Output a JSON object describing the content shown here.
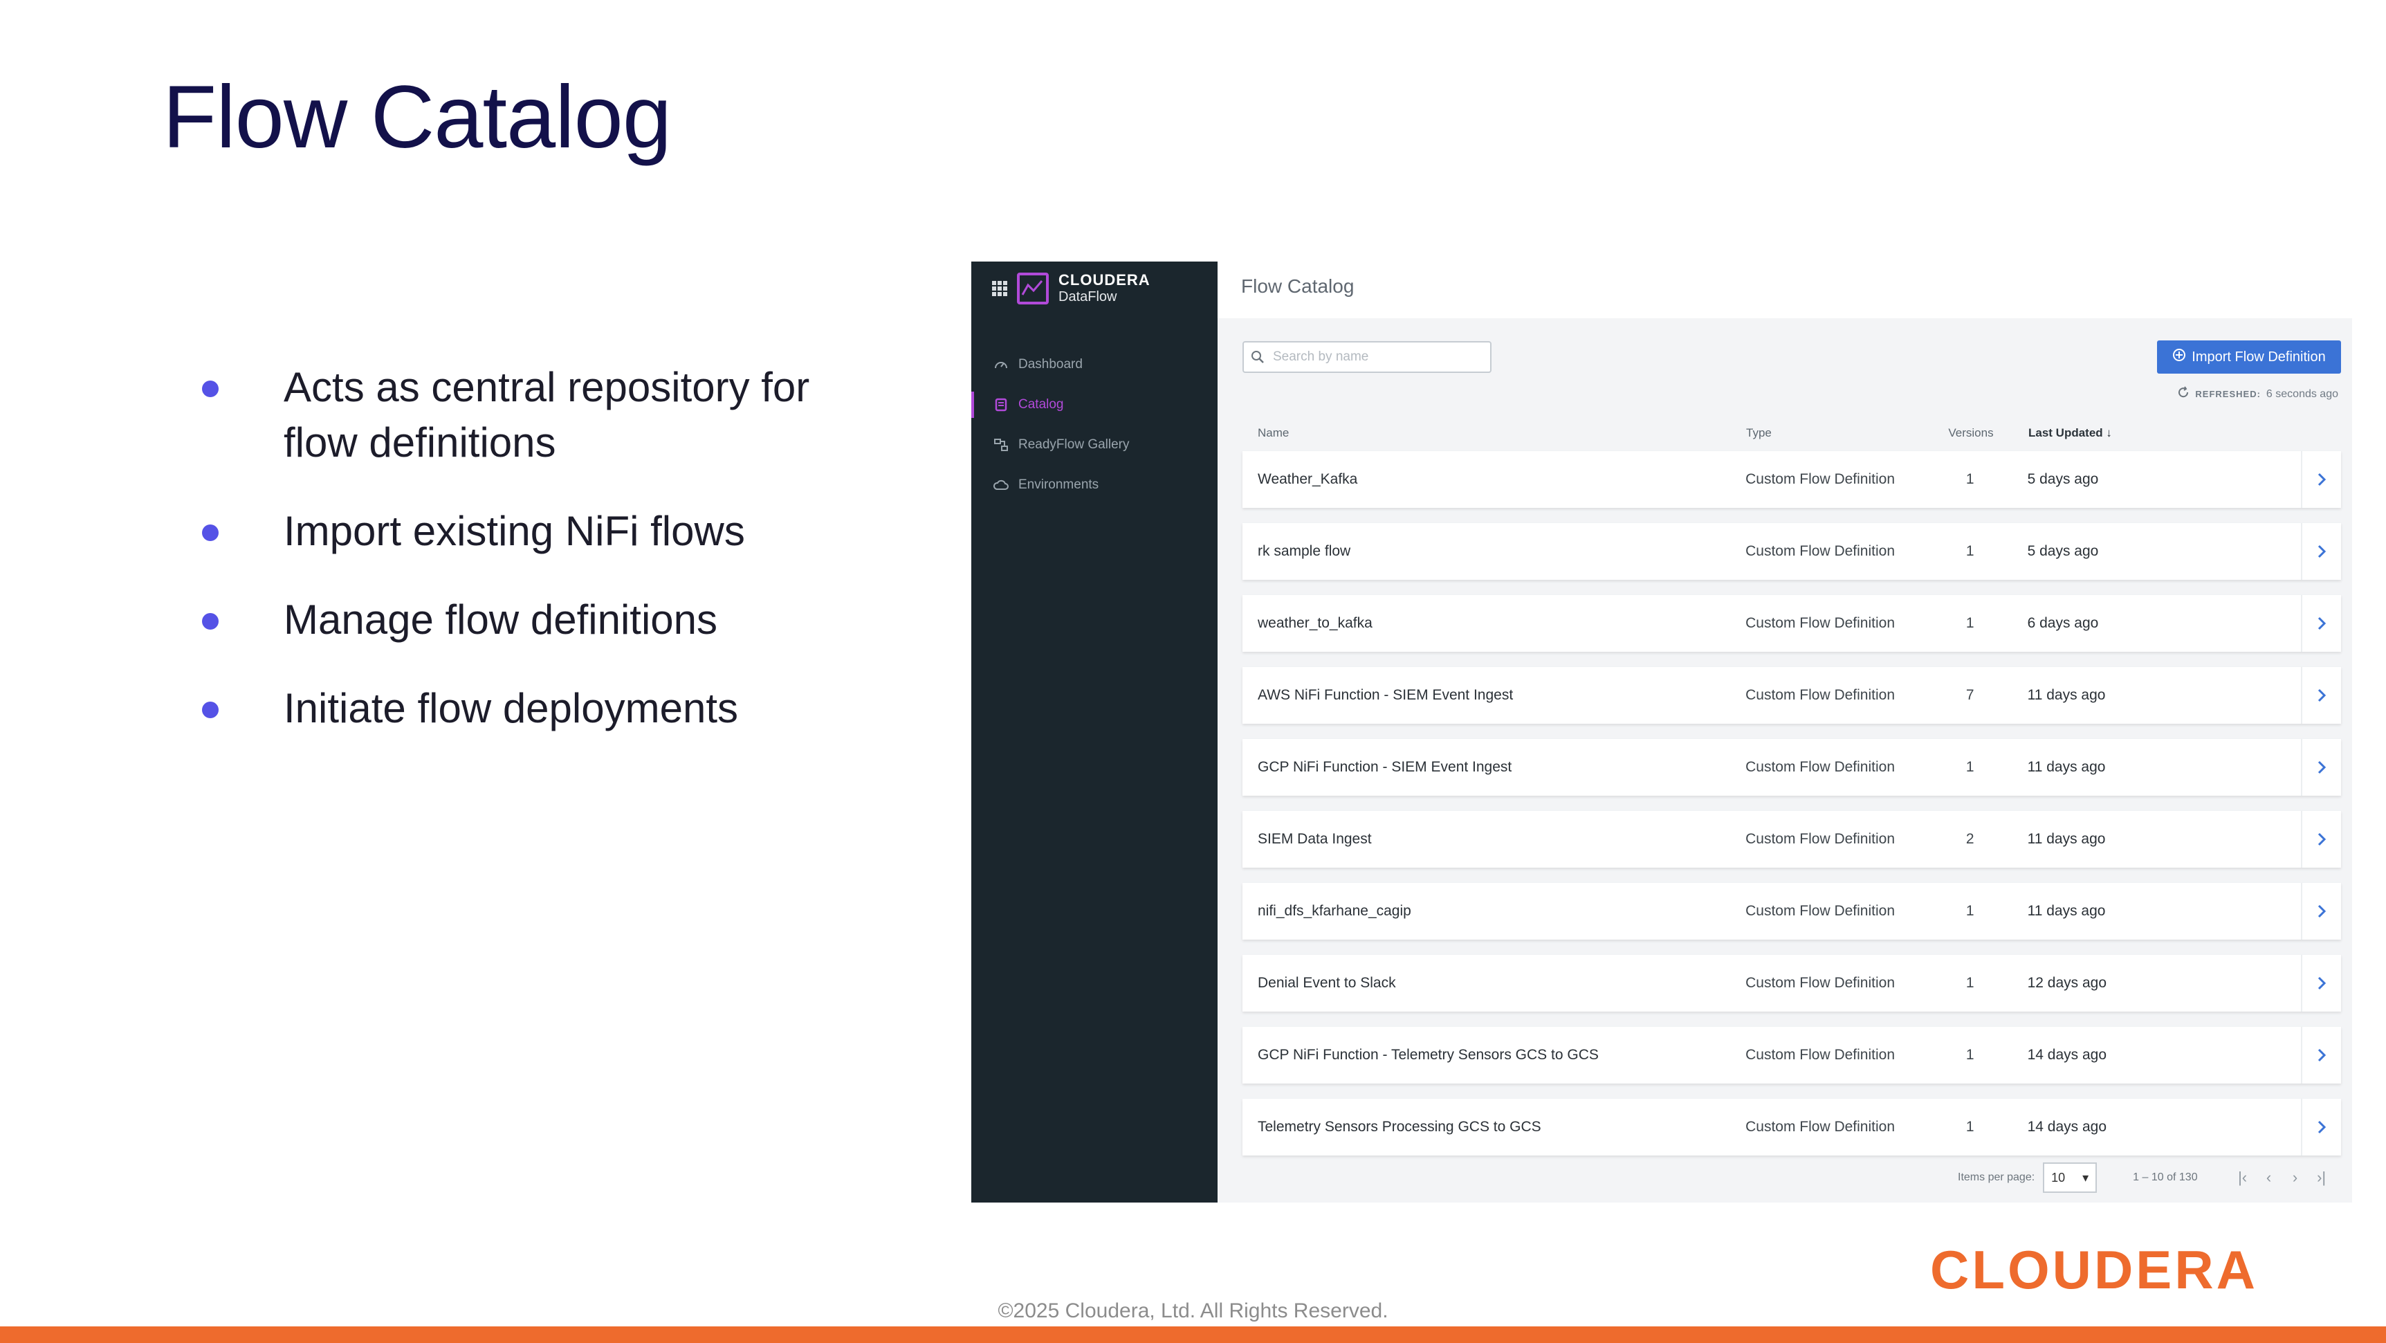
{
  "slide": {
    "title": "Flow Catalog",
    "bullets": [
      "Acts as central repository for flow definitions",
      "Import existing NiFi flows",
      "Manage flow definitions",
      "Initiate flow deployments"
    ],
    "logo": "CLOUDERA",
    "copyright": "©2025 Cloudera, Ltd. All Rights Reserved."
  },
  "app": {
    "brand_name": "CLOUDERA",
    "brand_product": "DataFlow",
    "nav": [
      {
        "label": "Dashboard",
        "icon": "gauge-icon",
        "active": false
      },
      {
        "label": "Catalog",
        "icon": "catalog-icon",
        "active": true
      },
      {
        "label": "ReadyFlow Gallery",
        "icon": "flow-gallery-icon",
        "active": false
      },
      {
        "label": "Environments",
        "icon": "cloud-icon",
        "active": false
      }
    ],
    "page_title": "Flow Catalog",
    "search_placeholder": "Search by name",
    "import_button": "Import Flow Definition",
    "refreshed_label": "REFRESHED:",
    "refreshed_value": "6 seconds ago",
    "columns": {
      "name": "Name",
      "type": "Type",
      "versions": "Versions",
      "last_updated": "Last Updated"
    },
    "rows": [
      {
        "name": "Weather_Kafka",
        "type": "Custom Flow Definition",
        "versions": "1",
        "updated": "5 days ago"
      },
      {
        "name": "rk sample flow",
        "type": "Custom Flow Definition",
        "versions": "1",
        "updated": "5 days ago"
      },
      {
        "name": "weather_to_kafka",
        "type": "Custom Flow Definition",
        "versions": "1",
        "updated": "6 days ago"
      },
      {
        "name": "AWS NiFi Function - SIEM Event Ingest",
        "type": "Custom Flow Definition",
        "versions": "7",
        "updated": "11 days ago"
      },
      {
        "name": "GCP NiFi Function - SIEM Event Ingest",
        "type": "Custom Flow Definition",
        "versions": "1",
        "updated": "11 days ago"
      },
      {
        "name": "SIEM Data Ingest",
        "type": "Custom Flow Definition",
        "versions": "2",
        "updated": "11 days ago"
      },
      {
        "name": "nifi_dfs_kfarhane_cagip",
        "type": "Custom Flow Definition",
        "versions": "1",
        "updated": "11 days ago"
      },
      {
        "name": "Denial Event to Slack",
        "type": "Custom Flow Definition",
        "versions": "1",
        "updated": "12 days ago"
      },
      {
        "name": "GCP NiFi Function - Telemetry Sensors GCS to GCS",
        "type": "Custom Flow Definition",
        "versions": "1",
        "updated": "14 days ago"
      },
      {
        "name": "Telemetry Sensors Processing GCS to GCS",
        "type": "Custom Flow Definition",
        "versions": "1",
        "updated": "14 days ago"
      }
    ],
    "pager": {
      "items_per_page_label": "Items per page:",
      "items_per_page": "10",
      "range": "1 – 10 of 130"
    }
  },
  "colors": {
    "title": "#13114a",
    "bullet": "#5552e6",
    "accent": "#ee6b2d",
    "sidebar": "#1b262d",
    "active_nav": "#b14ad9",
    "button": "#3b73d6"
  }
}
